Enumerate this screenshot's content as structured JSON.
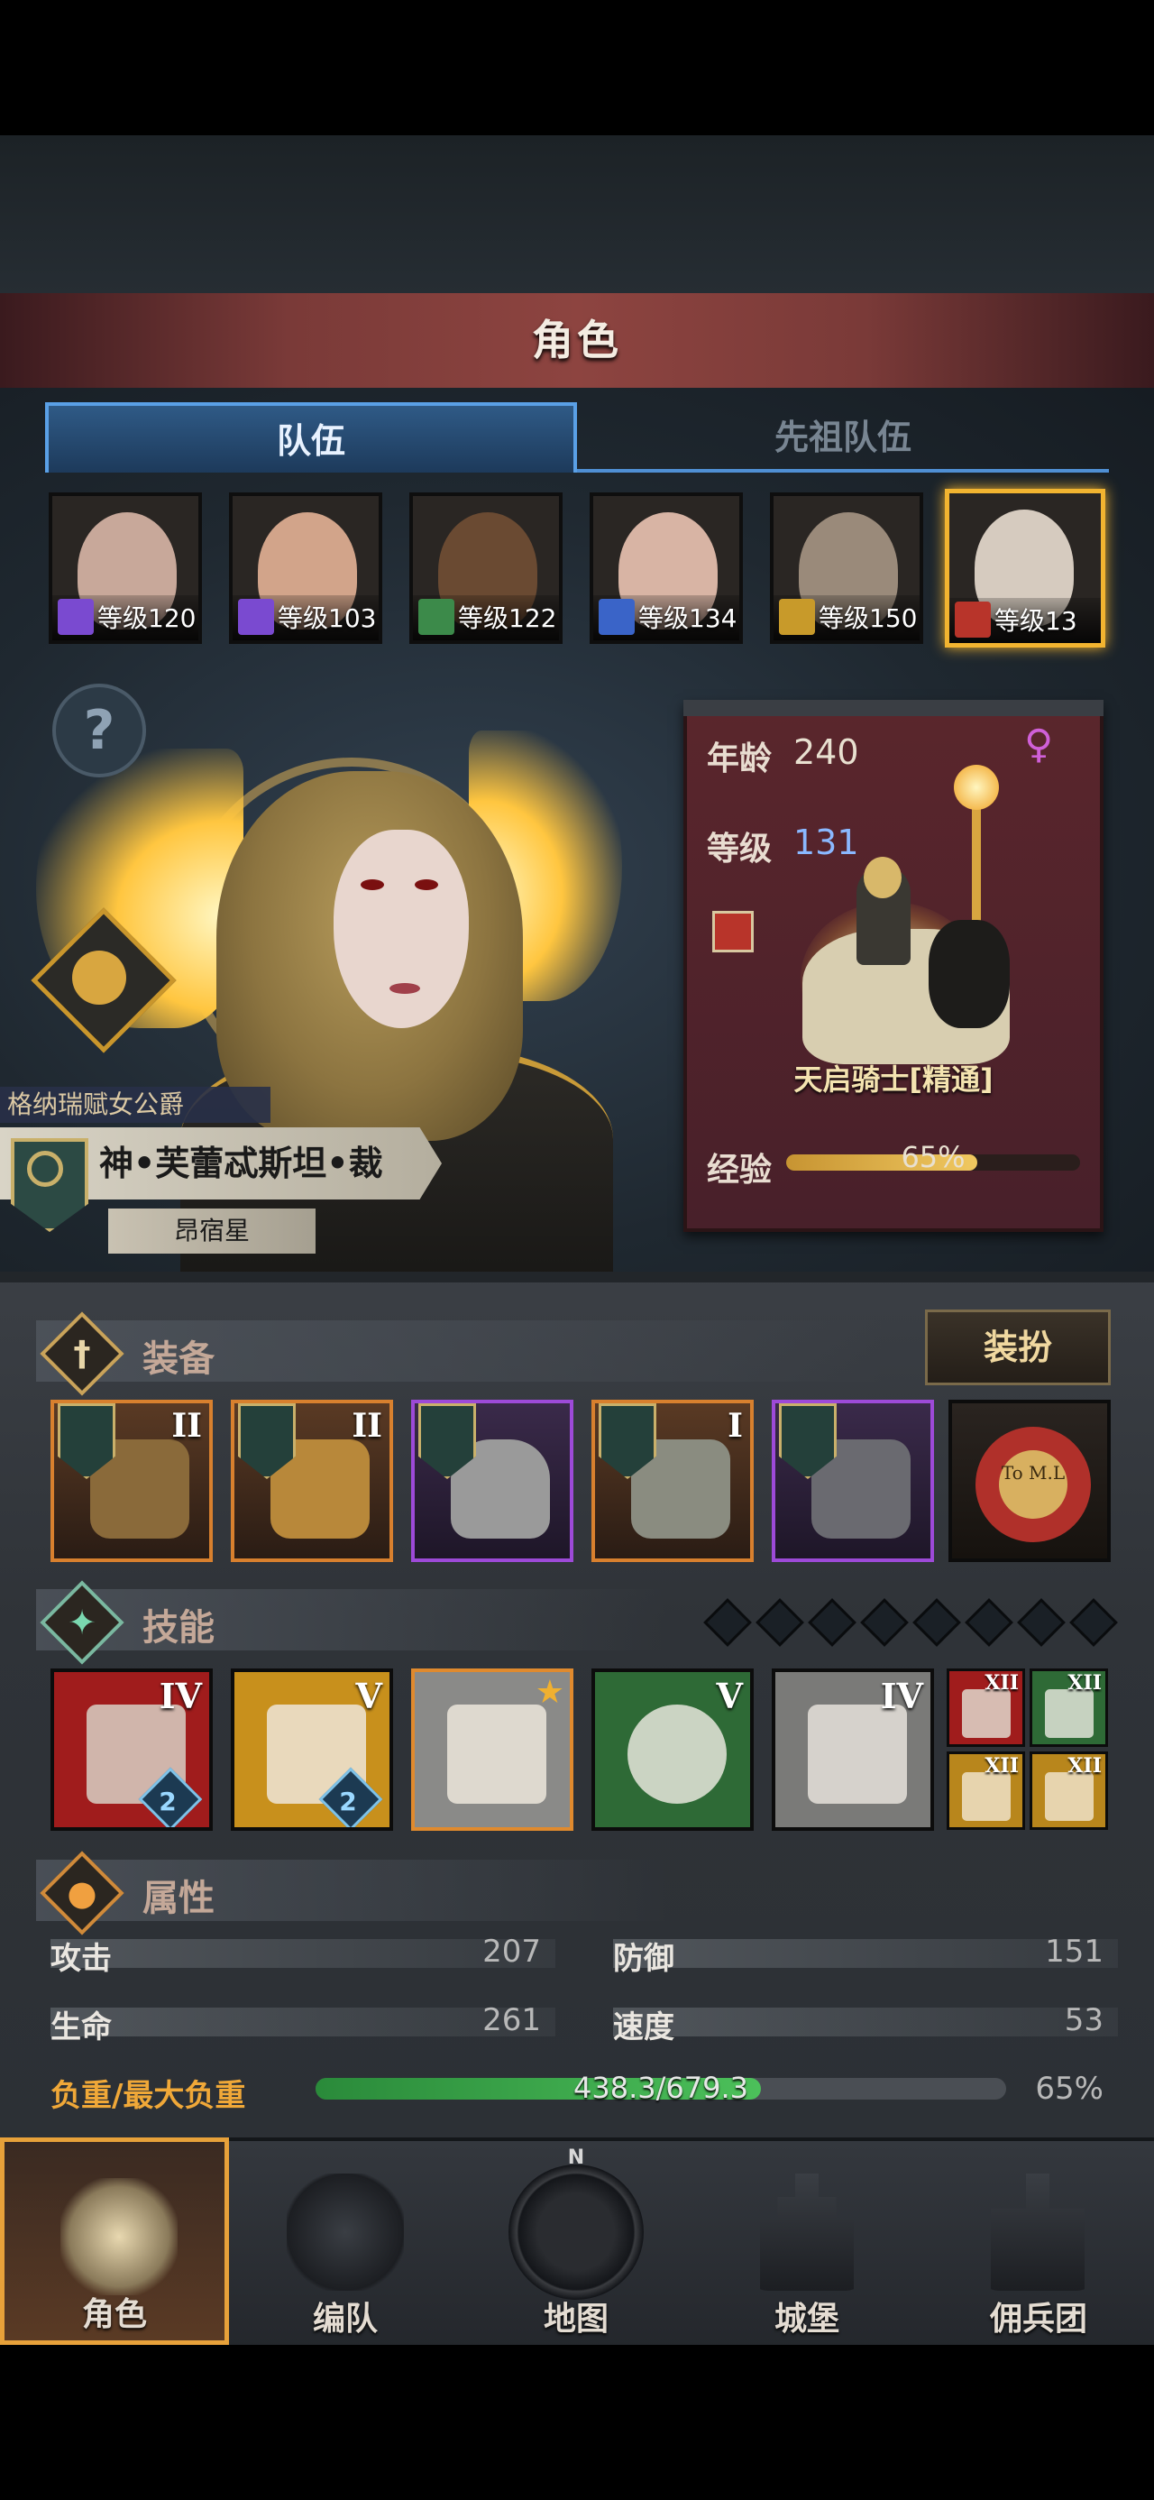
{
  "header": {
    "title": "角色"
  },
  "tabs": [
    {
      "label": "队伍",
      "active": true
    },
    {
      "label": "先祖队伍",
      "active": false
    }
  ],
  "team": [
    {
      "level_text": "等级120",
      "class_color": "#7a4ad0"
    },
    {
      "level_text": "等级103",
      "class_color": "#7a4ad0"
    },
    {
      "level_text": "等级122",
      "class_color": "#3c8a4a"
    },
    {
      "level_text": "等级134",
      "class_color": "#3a64c8"
    },
    {
      "level_text": "等级150",
      "class_color": "#c89a2a"
    },
    {
      "level_text": "等级13",
      "class_color": "#b8342a",
      "selected": true
    }
  ],
  "hero": {
    "title": "格纳瑞赋女公爵",
    "name": "神•芙蕾忒斯坦•裁",
    "star": "昂宿星"
  },
  "info": {
    "age_label": "年龄",
    "age": "240",
    "level_label": "等级",
    "level": "131",
    "class_name": "天启骑士[精通]",
    "exp_label": "经验",
    "exp_text": "65%",
    "exp_fraction": 0.65
  },
  "equipment": {
    "title": "装备",
    "dress_button": "装扮",
    "slots": [
      {
        "rank": "II",
        "rarity": "orange",
        "color": "#8a6a3a"
      },
      {
        "rank": "II",
        "rarity": "orange",
        "color": "#b8883a"
      },
      {
        "rank": "",
        "rarity": "purple",
        "color": "#9a9a9a"
      },
      {
        "rank": "I",
        "rarity": "orange",
        "color": "#8a8c80"
      },
      {
        "rank": "",
        "rarity": "purple",
        "color": "#6a6a70"
      },
      {
        "rank": "",
        "rarity": "none",
        "color": "#b0302a",
        "seal_text": "To M.L"
      }
    ]
  },
  "skills": {
    "title": "技能",
    "slots_total": 8,
    "items": [
      {
        "rank": "IV",
        "bg": "#a01c1c",
        "gem": "2"
      },
      {
        "rank": "V",
        "bg": "#c8901c",
        "gem": "2"
      },
      {
        "rank": "",
        "bg": "#8a8a88",
        "starred": true
      },
      {
        "rank": "V",
        "bg": "#2e6a36"
      },
      {
        "rank": "IV",
        "bg": "#7a7a78"
      }
    ],
    "minis": [
      {
        "rank": "XII",
        "bg": "#a01c1c"
      },
      {
        "rank": "XII",
        "bg": "#2e6a36"
      },
      {
        "rank": "XII",
        "bg": "#b8861c"
      },
      {
        "rank": "XII",
        "bg": "#b8861c"
      }
    ]
  },
  "attributes": {
    "title": "属性",
    "attack_label": "攻击",
    "attack": "207",
    "defense_label": "防御",
    "defense": "151",
    "hp_label": "生命",
    "hp": "261",
    "speed_label": "速度",
    "speed": "53",
    "load_label": "负重/最大负重",
    "load_text": "438.3/679.3",
    "load_pct": "65%",
    "load_fraction": 0.645
  },
  "nav": [
    {
      "label": "角色",
      "active": true
    },
    {
      "label": "编队"
    },
    {
      "label": "地图",
      "compass": "N"
    },
    {
      "label": "城堡"
    },
    {
      "label": "佣兵团"
    }
  ],
  "colors": {
    "gold_accent": "#e7a13a",
    "tab_blue": "#5aa0e6",
    "load_green": "#3ca64a"
  }
}
